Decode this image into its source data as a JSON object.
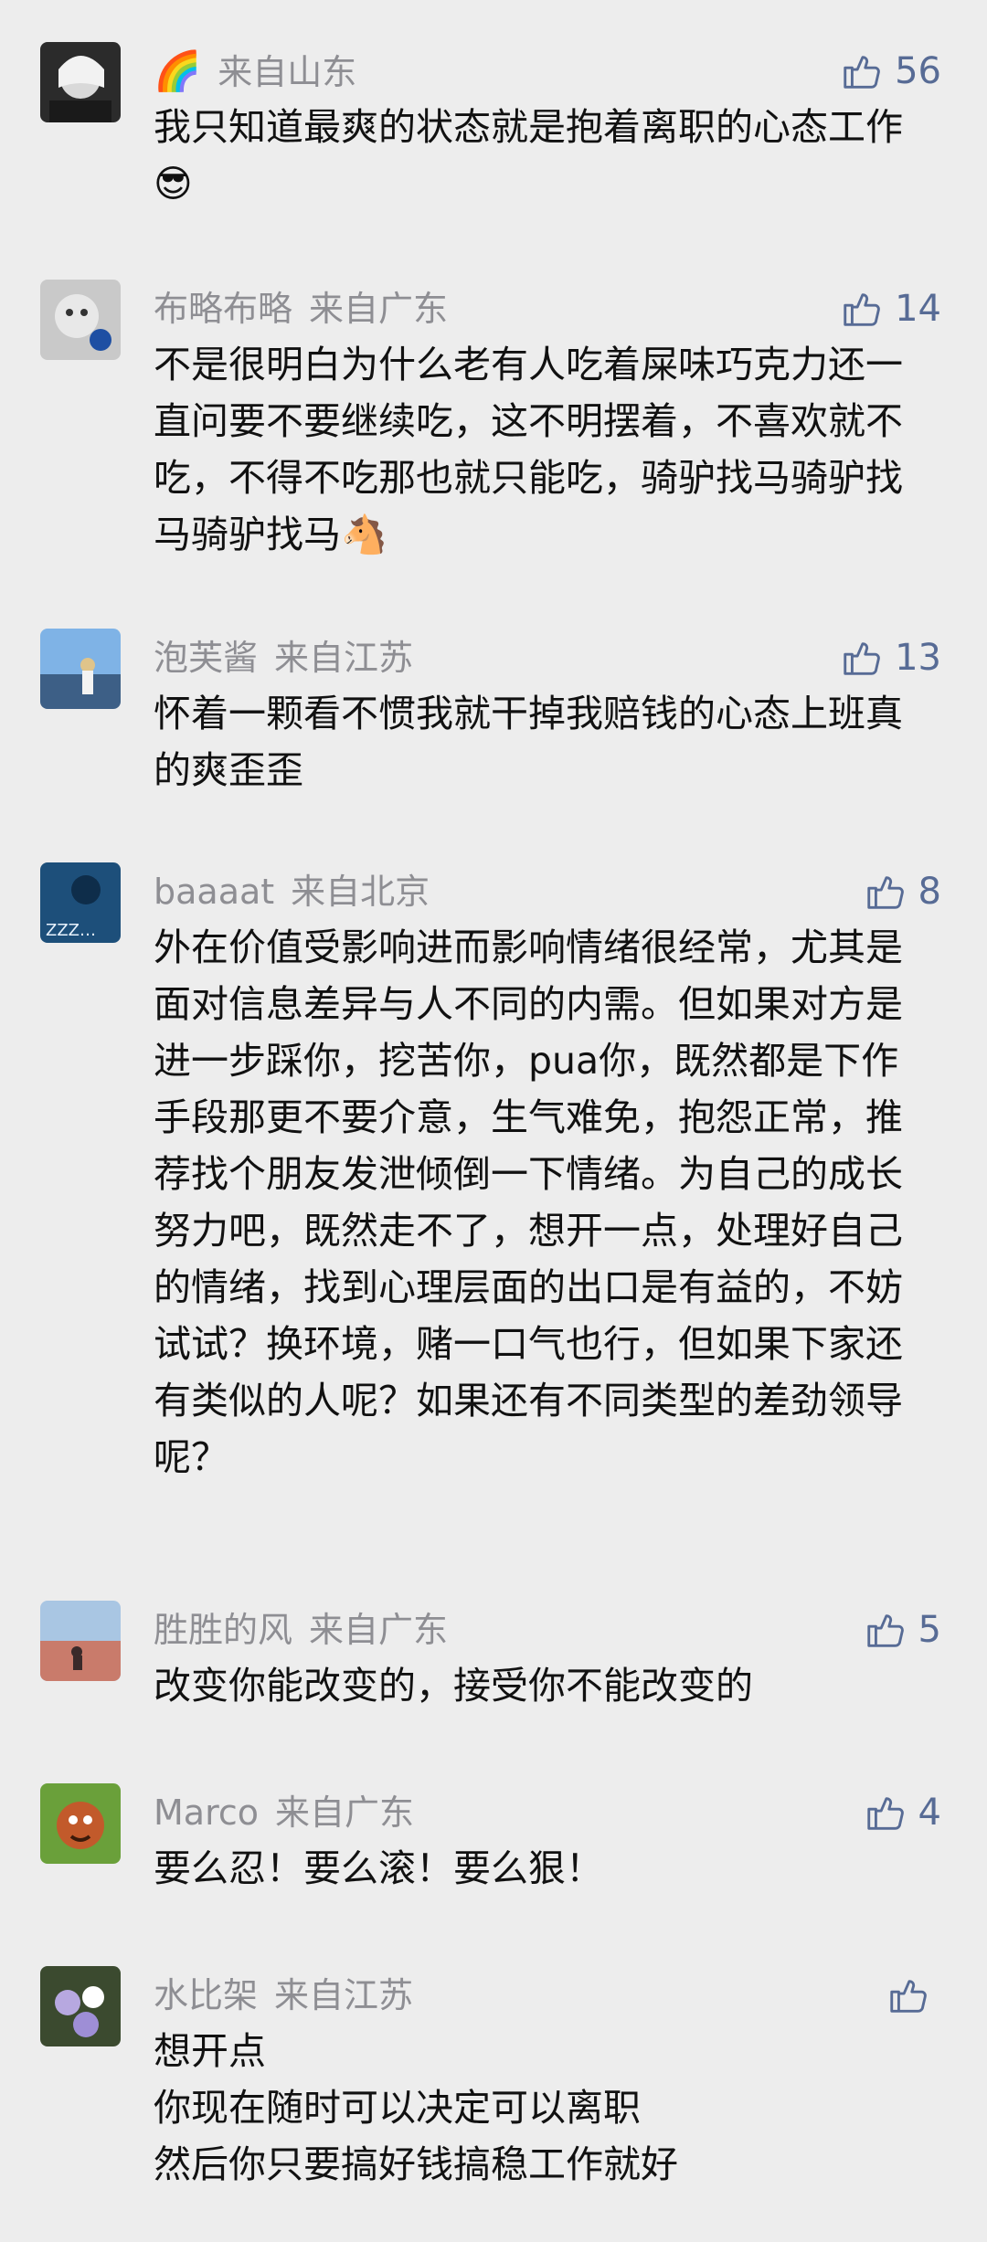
{
  "comments": [
    {
      "name": "",
      "flag": "🌈",
      "location": "来自山东",
      "likes": "56",
      "text": "我只知道最爽的状态就是抱着离职的心态工作😎"
    },
    {
      "name": "布略布略",
      "location": "来自广东",
      "likes": "14",
      "text": "不是很明白为什么老有人吃着屎味巧克力还一直问要不要继续吃，这不明摆着，不喜欢就不吃，不得不吃那也就只能吃，骑驴找马骑驴找马骑驴找马🐴"
    },
    {
      "name": "泡芙酱",
      "location": "来自江苏",
      "likes": "13",
      "text": "怀着一颗看不惯我就干掉我赔钱的心态上班真的爽歪歪"
    },
    {
      "name": "baaaat",
      "location": "来自北京",
      "likes": "8",
      "text": "外在价值受影响进而影响情绪很经常，尤其是面对信息差异与人不同的内需。但如果对方是进一步踩你，挖苦你，pua你，既然都是下作手段那更不要介意，生气难免，抱怨正常，推荐找个朋友发泄倾倒一下情绪。为自己的成长努力吧，既然走不了，想开一点，处理好自己的情绪，找到心理层面的出口是有益的，不妨试试？换环境，赌一口气也行，但如果下家还有类似的人呢？如果还有不同类型的差劲领导呢？"
    },
    {
      "name": "胜胜的风",
      "location": "来自广东",
      "likes": "5",
      "text": "改变你能改变的，接受你不能改变的"
    },
    {
      "name": "Marco",
      "location": "来自广东",
      "likes": "4",
      "text": "要么忍！要么滚！要么狠！"
    },
    {
      "name": "水比架",
      "location": "来自江苏",
      "likes": "",
      "text": "想开点\n你现在随时可以决定可以离职\n然后你只要搞好钱搞稳工作就好"
    }
  ],
  "colors": {
    "background": "#ededed",
    "meta": "#8e8e93",
    "like": "#576b95",
    "text": "#111111"
  },
  "icons": {
    "like": "thumbs-up-icon"
  }
}
